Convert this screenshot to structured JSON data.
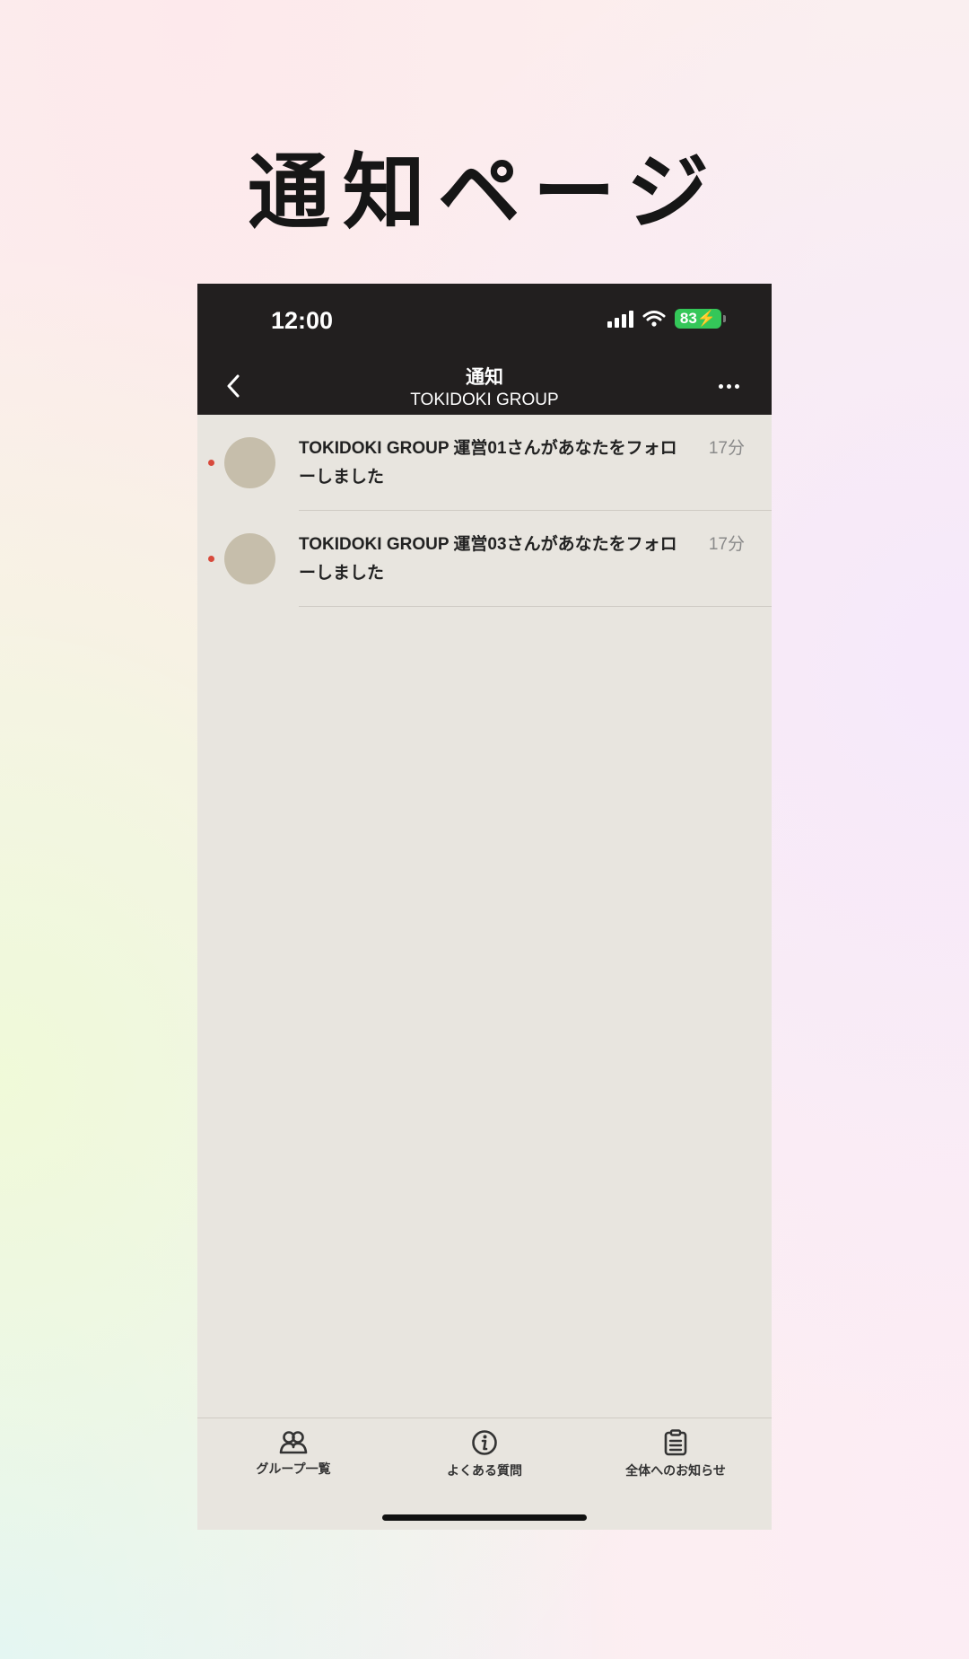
{
  "page_title": "通知ページ",
  "status_bar": {
    "time": "12:00",
    "battery": "83"
  },
  "nav": {
    "title": "通知",
    "subtitle": "TOKIDOKI GROUP"
  },
  "notifications": [
    {
      "text": "TOKIDOKI GROUP 運営01さんがあなたをフォローしました",
      "time": "17分",
      "unread": true
    },
    {
      "text": "TOKIDOKI GROUP 運営03さんがあなたをフォローしました",
      "time": "17分",
      "unread": true
    }
  ],
  "tabs": [
    {
      "label": "グループ一覧",
      "icon": "group-icon"
    },
    {
      "label": "よくある質問",
      "icon": "info-icon"
    },
    {
      "label": "全体へのお知らせ",
      "icon": "clipboard-icon"
    }
  ],
  "colors": {
    "header_bg": "#221f1f",
    "content_bg": "#e8e5df",
    "unread_dot": "#d84a3c",
    "avatar": "#c6beab",
    "battery": "#34c759"
  }
}
